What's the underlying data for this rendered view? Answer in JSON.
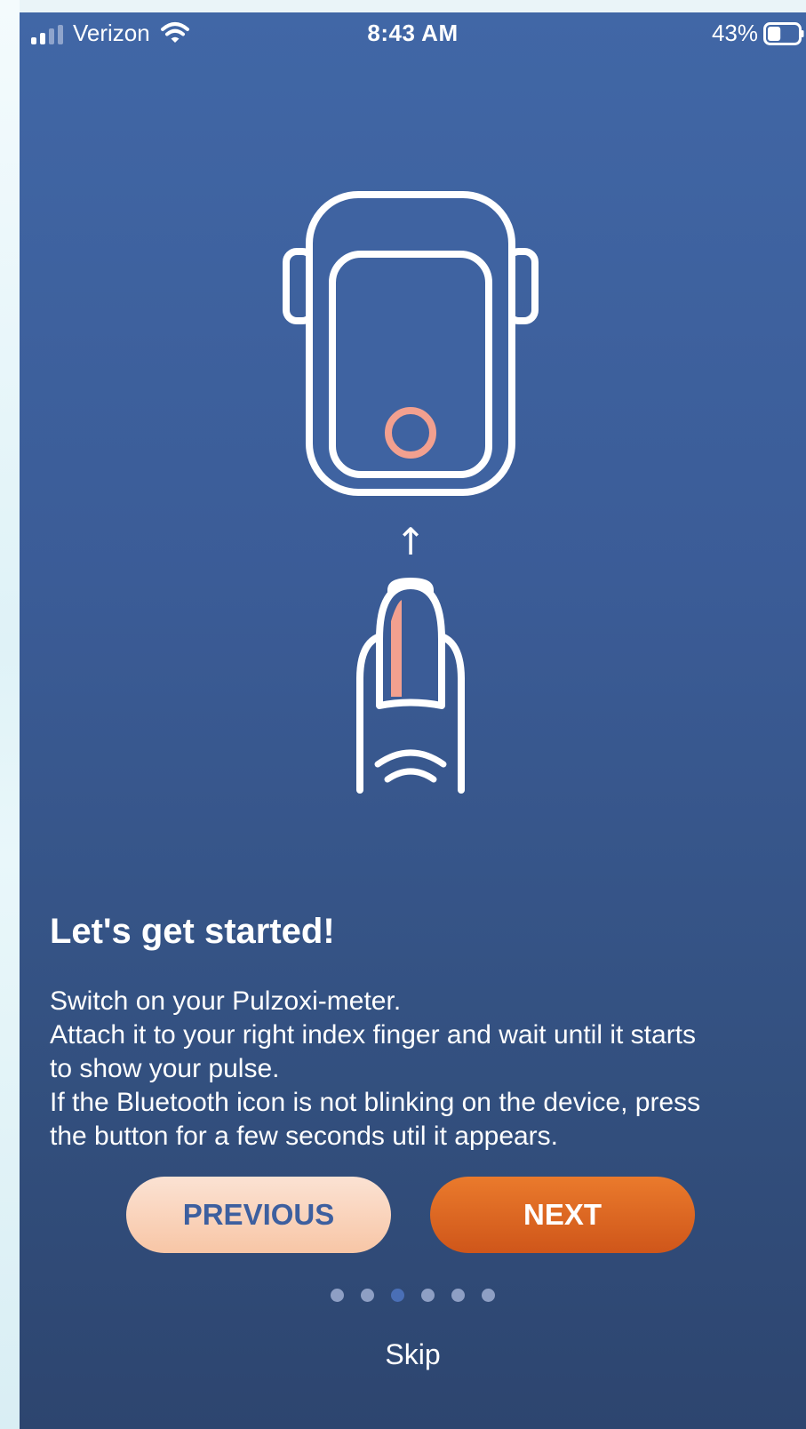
{
  "status_bar": {
    "carrier": "Verizon",
    "time": "8:43 AM",
    "battery_percent": "43%",
    "battery_level": 0.43,
    "icons": [
      "signal-icon",
      "wifi-icon",
      "battery-icon"
    ]
  },
  "illustration": {
    "icons": [
      "pulse-oximeter-icon",
      "arrow-up-icon",
      "finger-icon"
    ],
    "arrow_glyph": "↑",
    "accent_color": "#f2a08f"
  },
  "onboarding": {
    "heading": "Let's get started!",
    "lines": [
      "Switch on your Pulzoxi-meter.",
      "Attach it to your right index finger and wait until it starts",
      "to show your pulse.",
      "If the Bluetooth icon is not blinking on the device, press",
      "the button for a few seconds util it appears."
    ]
  },
  "buttons": {
    "previous": "PREVIOUS",
    "next": "NEXT"
  },
  "pagination": {
    "total": 6,
    "current_index": 2
  },
  "skip_label": "Skip",
  "colors": {
    "background_top": "#4167a6",
    "background_bottom": "#2d456f",
    "previous_button": "#f8c6a6",
    "next_button": "#e0692a",
    "dot_active": "#4a6fb6",
    "dot_inactive": "#8e9fc4"
  }
}
